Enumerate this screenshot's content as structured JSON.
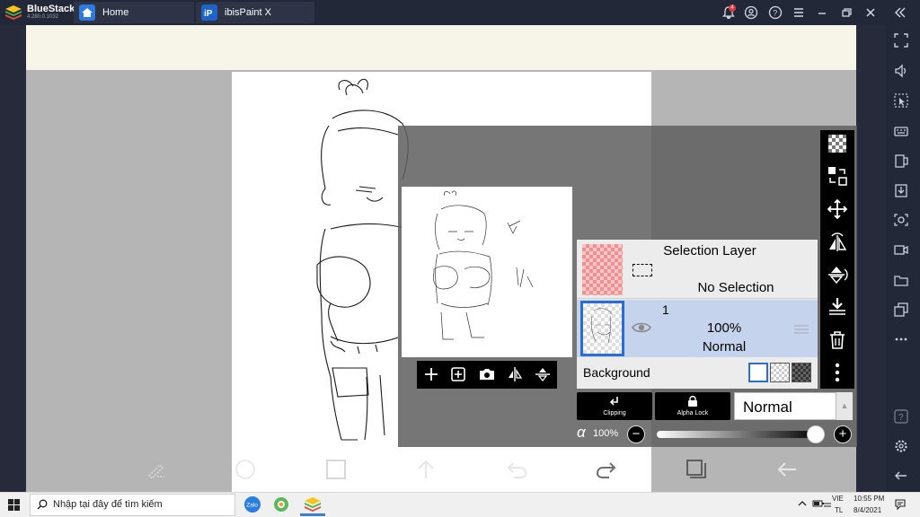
{
  "window": {
    "app_name": "BlueStacks",
    "app_version": "4.280.0.1032",
    "tabs": [
      {
        "label": "Home",
        "icon": "home-icon"
      },
      {
        "label": "ibisPaint X",
        "icon": "ibispaint-app-icon"
      }
    ],
    "notification_count": "4",
    "controls": [
      "bell-icon",
      "account-icon",
      "help-icon",
      "menu-icon",
      "minimize-icon",
      "restore-icon",
      "close-icon",
      "collapse-sidebar-icon"
    ]
  },
  "sidebar": {
    "items": [
      "fullscreen-icon",
      "volume-icon",
      "cursor-icon",
      "keyboard-icon",
      "screen-rotate-icon",
      "install-apk-icon",
      "screenshot-icon",
      "record-icon",
      "folder-icon",
      "multi-instance-icon",
      "more-icon",
      "help-icon",
      "settings-icon",
      "back-icon"
    ]
  },
  "layer_panel": {
    "selection_layer": {
      "title": "Selection Layer",
      "status": "No Selection"
    },
    "layers": [
      {
        "number": "1",
        "opacity": "100%",
        "blend": "Normal",
        "selected": true
      }
    ],
    "background": {
      "label": "Background",
      "options": [
        "white",
        "transparent",
        "dark"
      ]
    },
    "clipping_label": "Clipping",
    "alpha_lock_label": "Alpha Lock",
    "blend_mode": "Normal",
    "alpha_symbol": "α",
    "opacity_value": "100%",
    "opacity_fraction": 1.0,
    "minus_label": "−",
    "plus_label": "+"
  },
  "app_toolbar": [
    "pen-tool-icon",
    "brush-circle-icon",
    "color-square-icon",
    "up-arrow-icon",
    "undo-icon",
    "redo-icon",
    "layers-icon",
    "back-arrow-icon"
  ],
  "taskbar": {
    "search_placeholder": "Nhập tại đây để tìm kiếm",
    "language_line1": "VIE",
    "language_line2": "TL",
    "time": "10:55 PM",
    "date": "8/4/2021"
  },
  "colors": {
    "accent_blue": "#2a6dd4",
    "selected_layer_bg": "#c5d4ec",
    "titlebar_bg": "#232839"
  }
}
